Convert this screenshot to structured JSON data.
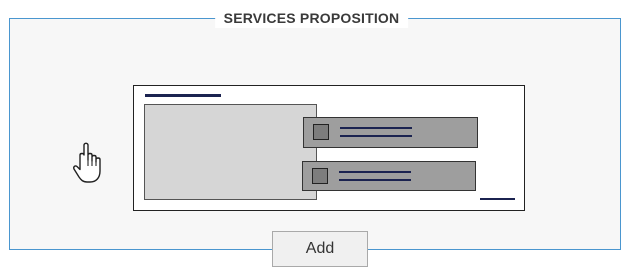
{
  "section": {
    "title": "SERVICES PROPOSITION"
  },
  "preview": {
    "icon": "layout-preview-icon"
  },
  "cursor": {
    "icon": "hand-pointer-icon"
  },
  "actions": {
    "add_label": "Add"
  },
  "colors": {
    "border_accent": "#4a96cf",
    "line_dark": "#1b2350",
    "block_gray": "#9e9e9e",
    "block_light": "#d6d6d6"
  }
}
